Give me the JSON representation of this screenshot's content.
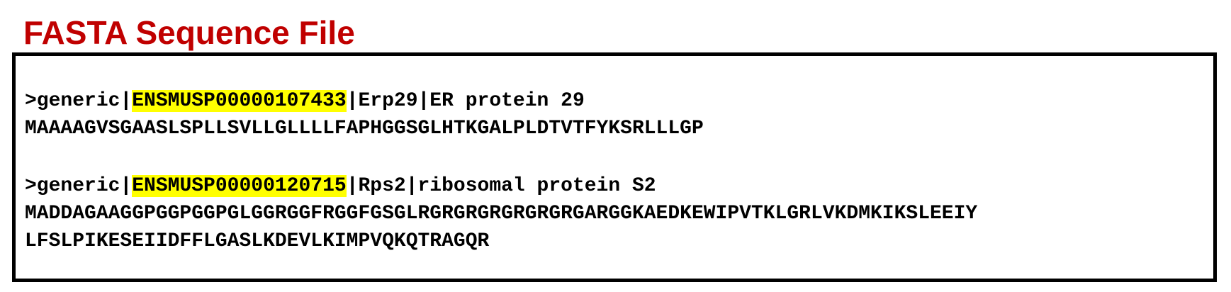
{
  "title": "FASTA Sequence File",
  "colors": {
    "title": "#c00000",
    "highlight": "#ffff00",
    "border": "#000000"
  },
  "records": [
    {
      "header_prefix": ">generic|",
      "accession": "ENSMUSP00000107433",
      "header_suffix": "|Erp29|ER protein 29",
      "sequence_lines": [
        "MAAAAGVSGAASLSPLLSVLLGLLLLFAPHGGSGLHTKGALPLDTVTFYKSRLLLGP"
      ]
    },
    {
      "header_prefix": ">generic|",
      "accession": "ENSMUSP00000120715",
      "header_suffix": "|Rps2|ribosomal protein S2",
      "sequence_lines": [
        "MADDAGAAGGPGGPGGPGLGGRGGFRGGFGSGLRGRGRGRGRGRGRGARGGKAEDKEWIPVTKLGRLVKDMKIKSLEEIY",
        "LFSLPIKESEIIDFFLGASLKDEVLKIMPVQKQTRAGQR"
      ]
    }
  ]
}
